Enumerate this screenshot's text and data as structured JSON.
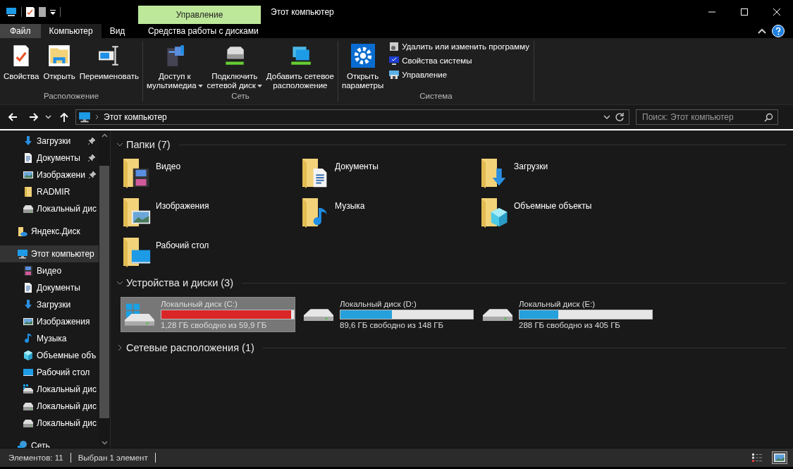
{
  "window": {
    "title": "Этот компьютер",
    "context_header": "Управление"
  },
  "tabs": [
    {
      "label": "Файл",
      "kind": "file",
      "selected": false
    },
    {
      "label": "Компьютер",
      "kind": "normal",
      "selected": true
    },
    {
      "label": "Вид",
      "kind": "normal",
      "selected": false
    },
    {
      "label": "Средства работы с дисками",
      "kind": "context",
      "selected": false
    }
  ],
  "ribbon": {
    "groups": [
      {
        "label": "Расположение",
        "large_buttons": [
          {
            "label": "Свойства",
            "kind": "properties",
            "dropdown": false
          },
          {
            "label": "Открыть",
            "kind": "open",
            "dropdown": false
          },
          {
            "label": "Переименовать",
            "kind": "rename",
            "dropdown": false
          }
        ]
      },
      {
        "label": "Сеть",
        "large_buttons": [
          {
            "label": "Доступ к",
            "label2": "мультимедиа",
            "kind": "media",
            "dropdown": true
          },
          {
            "label": "Подключить",
            "label2": "сетевой диск",
            "kind": "netdrive",
            "dropdown": true
          },
          {
            "label": "Добавить сетевое",
            "label2": "расположение",
            "kind": "netlocation",
            "dropdown": false
          }
        ]
      },
      {
        "label": "Система",
        "large_buttons": [
          {
            "label": "Открыть",
            "label2": "параметры",
            "kind": "settings",
            "dropdown": false
          }
        ],
        "small_buttons": [
          {
            "label": "Удалить или изменить программу",
            "kind": "uninstall"
          },
          {
            "label": "Свойства системы",
            "kind": "sysprops"
          },
          {
            "label": "Управление",
            "kind": "manage"
          }
        ]
      }
    ]
  },
  "address": {
    "path": "Этот компьютер",
    "search_placeholder": "Поиск: Этот компьютер"
  },
  "sidebar": {
    "quick_access": [
      {
        "label": "Загрузки",
        "kind": "download",
        "pinned": true
      },
      {
        "label": "Документы",
        "kind": "document",
        "pinned": true
      },
      {
        "label": "Изображени",
        "kind": "image",
        "pinned": true
      },
      {
        "label": "RADMIR",
        "kind": "folder",
        "pinned": false
      },
      {
        "label": "Локальный дис",
        "kind": "drive",
        "pinned": false
      }
    ],
    "items": [
      {
        "label": "Яндекс.Диск",
        "kind": "yandex",
        "selected": false
      },
      {
        "label": "Этот компьютер",
        "kind": "computer",
        "selected": true,
        "children": [
          {
            "label": "Видео",
            "kind": "video",
            "selected": false
          },
          {
            "label": "Документы",
            "kind": "document",
            "selected": false
          },
          {
            "label": "Загрузки",
            "kind": "download",
            "selected": false
          },
          {
            "label": "Изображения",
            "kind": "image",
            "selected": false
          },
          {
            "label": "Музыка",
            "kind": "music",
            "selected": false
          },
          {
            "label": "Объемные объ",
            "kind": "objects3d",
            "selected": false
          },
          {
            "label": "Рабочий стол",
            "kind": "desktop",
            "selected": false
          },
          {
            "label": "Локальный дис",
            "kind": "drivewin",
            "selected": false
          },
          {
            "label": "Локальный дис",
            "kind": "drive",
            "selected": false
          },
          {
            "label": "Локальный дис",
            "kind": "drive",
            "selected": false
          }
        ]
      },
      {
        "label": "Сеть",
        "kind": "network",
        "selected": false
      }
    ]
  },
  "sections": [
    {
      "title": "Папки (7)",
      "expanded": true,
      "kind": "folders",
      "items": [
        {
          "label": "Видео",
          "kind": "video"
        },
        {
          "label": "Документы",
          "kind": "document"
        },
        {
          "label": "Загрузки",
          "kind": "download"
        },
        {
          "label": "Изображения",
          "kind": "image"
        },
        {
          "label": "Музыка",
          "kind": "music"
        },
        {
          "label": "Объемные объекты",
          "kind": "objects3d"
        },
        {
          "label": "Рабочий стол",
          "kind": "desktop"
        }
      ]
    },
    {
      "title": "Устройства и диски (3)",
      "expanded": true,
      "kind": "drives",
      "items": [
        {
          "label": "Локальный диск (C:)",
          "free": "1,28 ГБ свободно из 59,9 ГБ",
          "level": 0.98,
          "low": true,
          "system": true,
          "selected": true
        },
        {
          "label": "Локальный диск (D:)",
          "free": "89,6 ГБ свободно из 148 ГБ",
          "level": 0.39,
          "low": false,
          "system": false,
          "selected": false
        },
        {
          "label": "Локальный диск (E:)",
          "free": "288 ГБ свободно из 405 ГБ",
          "level": 0.29,
          "low": false,
          "system": false,
          "selected": false
        }
      ]
    },
    {
      "title": "Сетевые расположения (1)",
      "expanded": false
    }
  ],
  "status_bar": {
    "count": "Элементов: 11",
    "selection": "Выбран 1 элемент",
    "views": [
      {
        "kind": "details",
        "selected": false
      },
      {
        "kind": "large",
        "selected": true
      }
    ]
  }
}
